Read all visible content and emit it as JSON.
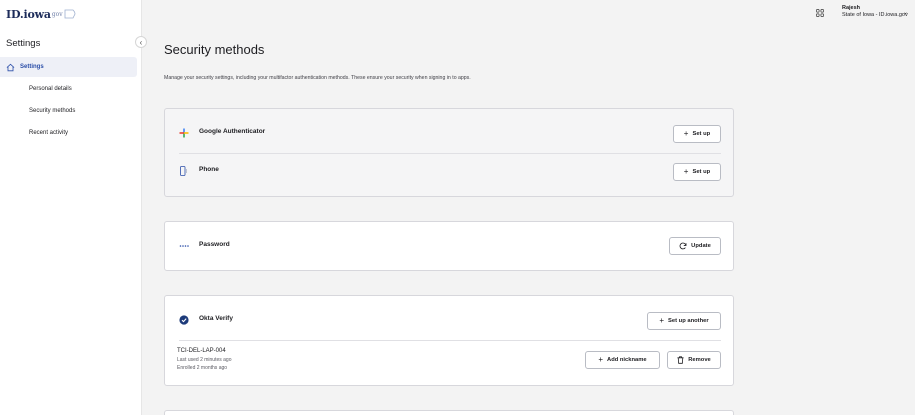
{
  "brand": {
    "logo_text": "ID.iowa",
    "logo_suffix": "gov"
  },
  "sidebar": {
    "title": "Settings",
    "active_item": "Settings",
    "items": [
      {
        "label": "Personal details"
      },
      {
        "label": "Security methods"
      },
      {
        "label": "Recent activity"
      }
    ]
  },
  "header": {
    "user_name": "Rajesh",
    "user_org": "State of Iowa - ID.iowa.gov"
  },
  "main": {
    "title": "Security methods",
    "description": "Manage your security settings, including your multifactor authentication methods. These ensure your security when signing in to apps."
  },
  "methods": {
    "google": {
      "name": "Google Authenticator",
      "action": "Set up"
    },
    "phone": {
      "name": "Phone",
      "action": "Set up"
    },
    "password": {
      "name": "Password",
      "action": "Update"
    },
    "okta": {
      "name": "Okta Verify",
      "action": "Set up another",
      "device": {
        "name": "TCI-DEL-LAP-004",
        "last_used": "Last used 2 minutes ago",
        "enrolled": "Enrolled 2 months ago",
        "nickname_action": "Add nickname",
        "remove_action": "Remove"
      }
    }
  },
  "colors": {
    "accent": "#2b4ea8",
    "okta_blue": "#1d3a7a",
    "google_red": "#ea4335",
    "google_blue": "#4285f4",
    "google_yellow": "#fbbc05",
    "google_green": "#34a853"
  }
}
